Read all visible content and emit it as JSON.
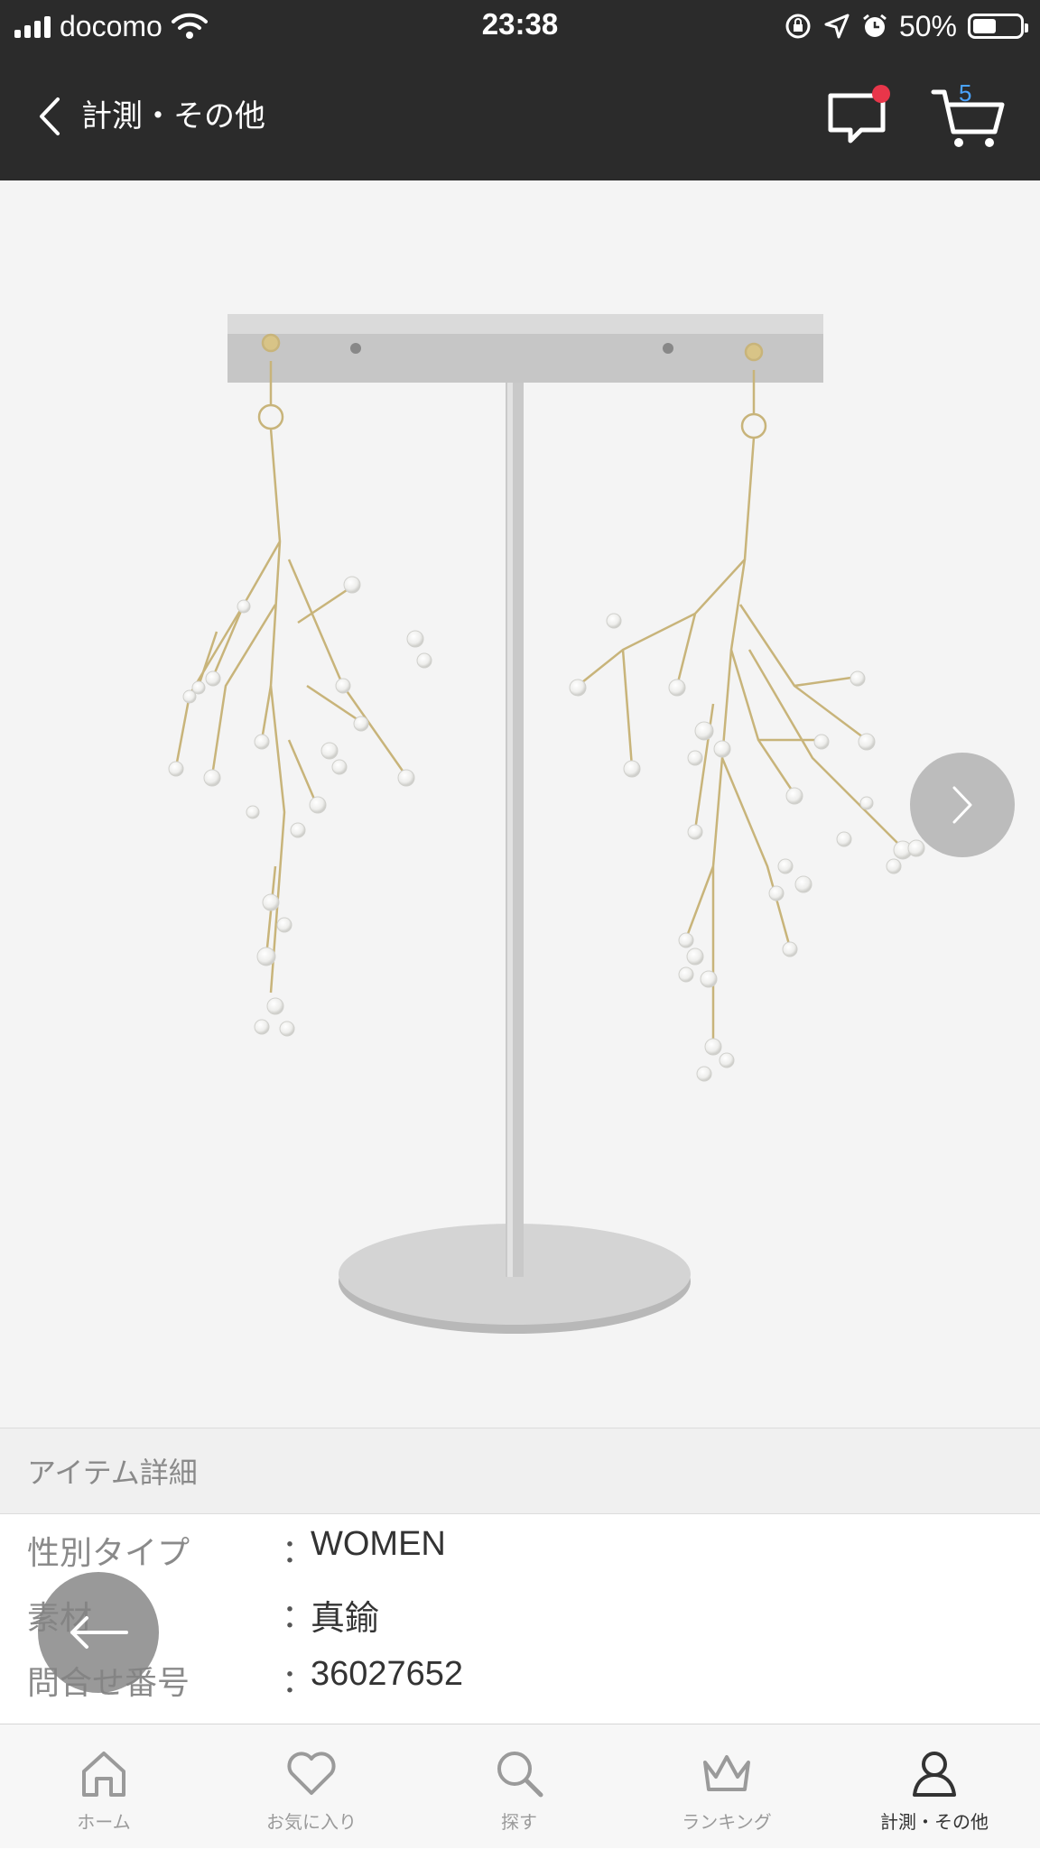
{
  "status_bar": {
    "carrier": "docomo",
    "time": "23:38",
    "battery_percent": "50%",
    "battery_level": 0.5
  },
  "header": {
    "title": "計測・その他",
    "cart_count": "5",
    "has_unread_message": true
  },
  "product": {
    "image_count_hint": "next"
  },
  "details_section": {
    "title": "アイテム詳細",
    "rows": [
      {
        "label": "性別タイプ",
        "colon": "：",
        "value": "WOMEN"
      },
      {
        "label": "素材",
        "colon": "：",
        "value": "真鍮"
      },
      {
        "label": "問合せ番号",
        "colon": "：",
        "value": "36027652"
      }
    ]
  },
  "tabs": [
    {
      "label": "ホーム",
      "icon": "home-icon",
      "active": false
    },
    {
      "label": "お気に入り",
      "icon": "heart-icon",
      "active": false
    },
    {
      "label": "探す",
      "icon": "search-icon",
      "active": false
    },
    {
      "label": "ランキング",
      "icon": "crown-icon",
      "active": false
    },
    {
      "label": "計測・その他",
      "icon": "user-icon",
      "active": true
    }
  ],
  "colors": {
    "bar_background": "#2b2b2b",
    "notification_dot": "#e8364a",
    "cart_count": "#4aa3ff"
  }
}
